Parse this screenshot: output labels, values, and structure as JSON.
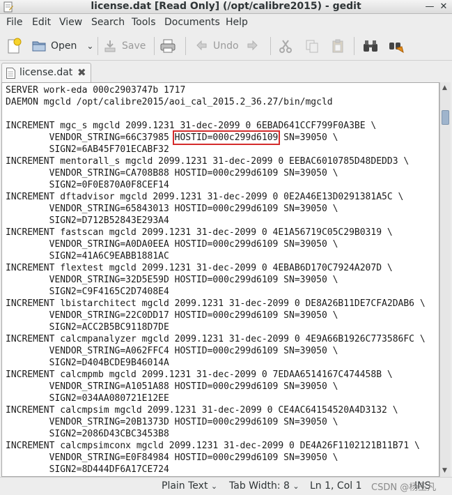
{
  "window": {
    "title": "license.dat [Read Only] (/opt/calibre2015) - gedit",
    "minimize_glyph": "—",
    "close_glyph": "✕"
  },
  "menu": [
    "File",
    "Edit",
    "View",
    "Search",
    "Tools",
    "Documents",
    "Help"
  ],
  "toolbar": {
    "open_label": "Open",
    "save_label": "Save",
    "undo_label": "Undo"
  },
  "tab": {
    "label": "license.dat",
    "close_glyph": "✖"
  },
  "editor": {
    "lines": [
      "SERVER work-eda 000c2903747b 1717",
      "DAEMON mgcld /opt/calibre2015/aoi_cal_2015.2_36.27/bin/mgcld",
      "",
      "INCREMENT mgc_s mgcld 2099.1231 31-dec-2099 0 6EBAD641CCF799F0A3BE \\",
      "        VENDOR_STRING=66C37985 ",
      "        SIGN2=6AB45F701ECABF32",
      "INCREMENT mentorall_s mgcld 2099.1231 31-dec-2099 0 EEBAC6010785D48DEDD3 \\",
      "        VENDOR_STRING=CA708B88 HOSTID=000c299d6109 SN=39050 \\",
      "        SIGN2=0F0E870A0F8CEF14",
      "INCREMENT dftadvisor mgcld 2099.1231 31-dec-2099 0 0E2A46E13D0291381A5C \\",
      "        VENDOR_STRING=65843013 HOSTID=000c299d6109 SN=39050 \\",
      "        SIGN2=D712B52843E293A4",
      "INCREMENT fastscan mgcld 2099.1231 31-dec-2099 0 4E1A56719C05C29B0319 \\",
      "        VENDOR_STRING=A0DA0EEA HOSTID=000c299d6109 SN=39050 \\",
      "        SIGN2=41A6C9EABB1881AC",
      "INCREMENT flextest mgcld 2099.1231 31-dec-2099 0 4EBAB6D170C7924A207D \\",
      "        VENDOR_STRING=32D5E59D HOSTID=000c299d6109 SN=39050 \\",
      "        SIGN2=C9F4165C2D7408E4",
      "INCREMENT lbistarchitect mgcld 2099.1231 31-dec-2099 0 DE8A26B11DE7CFA2DAB6 \\",
      "        VENDOR_STRING=22C0DD17 HOSTID=000c299d6109 SN=39050 \\",
      "        SIGN2=ACC2B5BC9118D7DE",
      "INCREMENT calcmpanalyzer mgcld 2099.1231 31-dec-2099 0 4E9A66B1926C773586FC \\",
      "        VENDOR_STRING=A062FFC4 HOSTID=000c299d6109 SN=39050 \\",
      "        SIGN2=D404BCDE9B46014A",
      "INCREMENT calcmpmb mgcld 2099.1231 31-dec-2099 0 7EDAA6514167C474458B \\",
      "        VENDOR_STRING=A1051A88 HOSTID=000c299d6109 SN=39050 \\",
      "        SIGN2=034AA080721E12EE",
      "INCREMENT calcmpsim mgcld 2099.1231 31-dec-2099 0 CE4AC64154520A4D3132 \\",
      "        VENDOR_STRING=20B1373D HOSTID=000c299d6109 SN=39050 \\",
      "        SIGN2=2086D43CBC3453B8",
      "INCREMENT calcmpsimconx mgcld 2099.1231 31-dec-2099 0 DE4A26F1102121B11B71 \\",
      "        VENDOR_STRING=E0F84984 HOSTID=000c299d6109 SN=39050 \\",
      "        SIGN2=8D444DF6A17CE724"
    ],
    "highlight_text": "HOSTID=000c299d6109",
    "highlight_after": " SN=39050 \\",
    "highlight_color": "#d42b2b"
  },
  "status": {
    "language": "Plain Text",
    "tab_width_label": "Tab Width:",
    "tab_width_value": "8",
    "position": "Ln 1, Col 1",
    "mode": "INS",
    "watermark": "CSDN @杨王凡"
  },
  "colors": {
    "accent": "#d42b2b",
    "thumb": "#9fb4cc"
  }
}
